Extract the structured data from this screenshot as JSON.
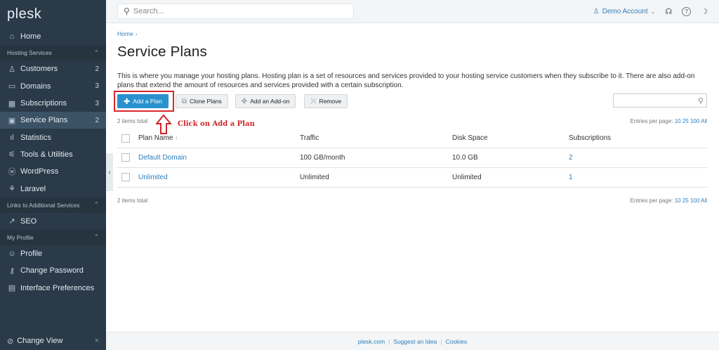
{
  "sidebar": {
    "logo": "plesk",
    "items": [
      {
        "key": "home",
        "icon": "home-icon",
        "glyph": "⌂",
        "label": "Home",
        "count": ""
      },
      {
        "section": true,
        "label": "Hosting Services",
        "chev": "⌃"
      },
      {
        "key": "customers",
        "icon": "user-icon",
        "glyph": "♙",
        "label": "Customers",
        "count": "2"
      },
      {
        "key": "domains",
        "icon": "monitor-icon",
        "glyph": "▭",
        "label": "Domains",
        "count": "3"
      },
      {
        "key": "subscriptions",
        "icon": "grid-icon",
        "glyph": "▦",
        "label": "Subscriptions",
        "count": "3"
      },
      {
        "key": "service-plans",
        "icon": "book-icon",
        "glyph": "▣",
        "label": "Service Plans",
        "count": "2",
        "active": true
      },
      {
        "key": "statistics",
        "icon": "bar-chart-icon",
        "glyph": "ıl",
        "label": "Statistics",
        "count": ""
      },
      {
        "key": "tools",
        "icon": "sliders-icon",
        "glyph": "⚟",
        "label": "Tools & Utilities",
        "count": ""
      },
      {
        "key": "wordpress",
        "icon": "wordpress-icon",
        "glyph": "ⓦ",
        "label": "WordPress",
        "count": ""
      },
      {
        "key": "laravel",
        "icon": "laravel-icon",
        "glyph": "⚘",
        "label": "Laravel",
        "count": ""
      },
      {
        "section": true,
        "label": "Links to Additional Services",
        "chev": "⌃"
      },
      {
        "key": "seo",
        "icon": "chart-up-icon",
        "glyph": "↗",
        "label": "SEO",
        "count": ""
      },
      {
        "section": true,
        "label": "My Profile",
        "chev": "⌃"
      },
      {
        "key": "profile",
        "icon": "profile-icon",
        "glyph": "☺",
        "label": "Profile",
        "count": ""
      },
      {
        "key": "change-password",
        "icon": "key-icon",
        "glyph": "⚷",
        "label": "Change Password",
        "count": ""
      },
      {
        "key": "interface-preferences",
        "icon": "window-icon",
        "glyph": "▤",
        "label": "Interface Preferences",
        "count": ""
      }
    ],
    "bottom": {
      "label": "Change View",
      "icon": "settings-circle-icon",
      "glyph": "⊘",
      "close": "×"
    },
    "collapse_glyph": "‹"
  },
  "topbar": {
    "search_placeholder": "Search...",
    "account": "Demo Account",
    "icons": [
      {
        "name": "ideas-icon",
        "glyph": "☊"
      },
      {
        "name": "help-icon",
        "glyph": "?"
      },
      {
        "name": "moon-icon",
        "glyph": "☽"
      }
    ]
  },
  "main": {
    "breadcrumb": "Home",
    "title": "Service Plans",
    "description": "This is where you manage your hosting plans. Hosting plan is a set of resources and services provided to your hosting service customers when they subscribe to it. There are also add-on plans that extend the amount of resources and services provided with a certain subscription.",
    "buttons": {
      "add_plan": "Add a Plan",
      "clone_plans": "Clone Plans",
      "add_addon": "Add an Add-on",
      "remove": "Remove"
    },
    "annotation": "Click on Add a Plan",
    "items_total": "2 items total",
    "entries_label": "Entries per page:",
    "entries_options": "10 25 100 All",
    "columns": [
      "Plan Name",
      "Traffic",
      "Disk Space",
      "Subscriptions"
    ],
    "rows": [
      {
        "name": "Default Domain",
        "traffic": "100 GB/month",
        "disk": "10.0 GB",
        "subs": "2"
      },
      {
        "name": "Unlimited",
        "traffic": "Unlimited",
        "disk": "Unlimited",
        "subs": "1"
      }
    ]
  },
  "footer": {
    "links": [
      "plesk.com",
      "Suggest an Idea",
      "Cookies"
    ]
  },
  "colors": {
    "sidebar_bg": "#2a3a48",
    "active_bg": "#3b5265",
    "primary": "#2a91cf",
    "link": "#2f7fbf",
    "annotation": "#d0232a"
  }
}
